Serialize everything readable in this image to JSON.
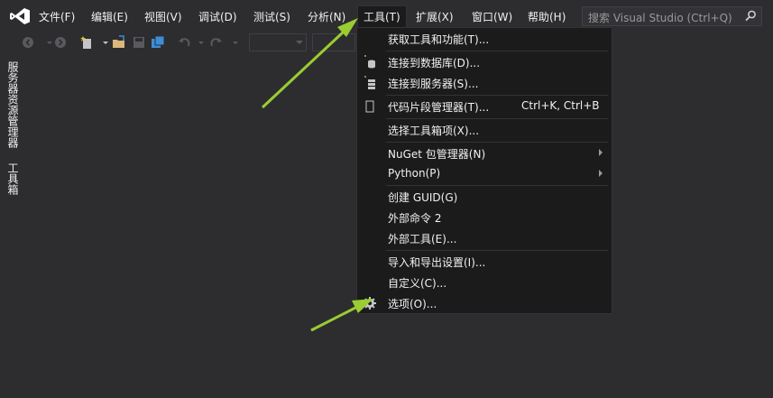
{
  "menubar": {
    "items": [
      {
        "label": "文件(F)"
      },
      {
        "label": "编辑(E)"
      },
      {
        "label": "视图(V)"
      },
      {
        "label": "调试(D)"
      },
      {
        "label": "测试(S)"
      },
      {
        "label": "分析(N)"
      },
      {
        "label": "工具(T)",
        "active": true
      },
      {
        "label": "扩展(X)"
      },
      {
        "label": "窗口(W)"
      },
      {
        "label": "帮助(H)"
      }
    ],
    "search_placeholder": "搜索 Visual Studio (Ctrl+Q)"
  },
  "side_tabs": [
    "服务器资源管理器",
    "工具箱"
  ],
  "tools_menu": {
    "items": [
      {
        "label": "获取工具和功能(T)..."
      },
      {
        "label": "连接到数据库(D)...",
        "icon": "database-connect-icon"
      },
      {
        "label": "连接到服务器(S)...",
        "icon": "server-connect-icon"
      },
      {
        "label": "代码片段管理器(T)...",
        "shortcut": "Ctrl+K, Ctrl+B",
        "icon": "snippet-icon"
      },
      {
        "label": "选择工具箱项(X)..."
      },
      {
        "label": "NuGet 包管理器(N)",
        "submenu": true
      },
      {
        "label": "Python(P)",
        "submenu": true
      },
      {
        "label": "创建 GUID(G)"
      },
      {
        "label": "外部命令 2"
      },
      {
        "label": "外部工具(E)..."
      },
      {
        "label": "导入和导出设置(I)..."
      },
      {
        "label": "自定义(C)..."
      },
      {
        "label": "选项(O)...",
        "icon": "gear-icon"
      }
    ]
  },
  "colors": {
    "background": "#2d2d30",
    "menu_background": "#1b1b1c",
    "text": "#f1f1f1",
    "vs_purple": "#68217a",
    "annotation_arrow": "#9acd32"
  }
}
